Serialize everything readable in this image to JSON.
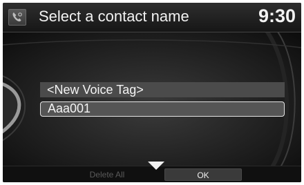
{
  "header": {
    "icon": "phone-settings-icon",
    "title": "Select a contact name",
    "clock": "9:30"
  },
  "list": {
    "items": [
      {
        "label": "<New Voice Tag>",
        "selected": false
      },
      {
        "label": "Aaa001",
        "selected": true
      }
    ]
  },
  "footer": {
    "scroll_icon": "scroll-down-arrow-icon",
    "delete_all_label": "Delete All",
    "delete_all_enabled": false,
    "ok_label": "OK"
  }
}
